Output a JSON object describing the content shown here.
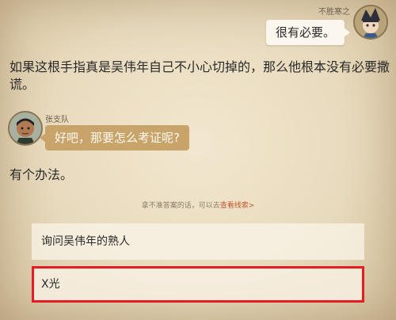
{
  "dialogue": {
    "speaker1": {
      "name": "不胜寒之",
      "line": "很有必要。"
    },
    "narration1": "如果这根手指真是吴伟年自己不小心切掉的，那么他根本没有必要撒谎。",
    "speaker2": {
      "name": "张支队",
      "line": "好吧，那要怎么考证呢?"
    },
    "narration2": "有个办法。"
  },
  "hint": {
    "text": "拿不准答案的话，可以去",
    "link": "查看线索>"
  },
  "options": [
    {
      "label": "询问吴伟年的熟人"
    },
    {
      "label": "X光"
    }
  ],
  "colors": {
    "highlight": "#e51c24",
    "link": "#c5572f",
    "bubble_brown": "#c9a46a"
  }
}
